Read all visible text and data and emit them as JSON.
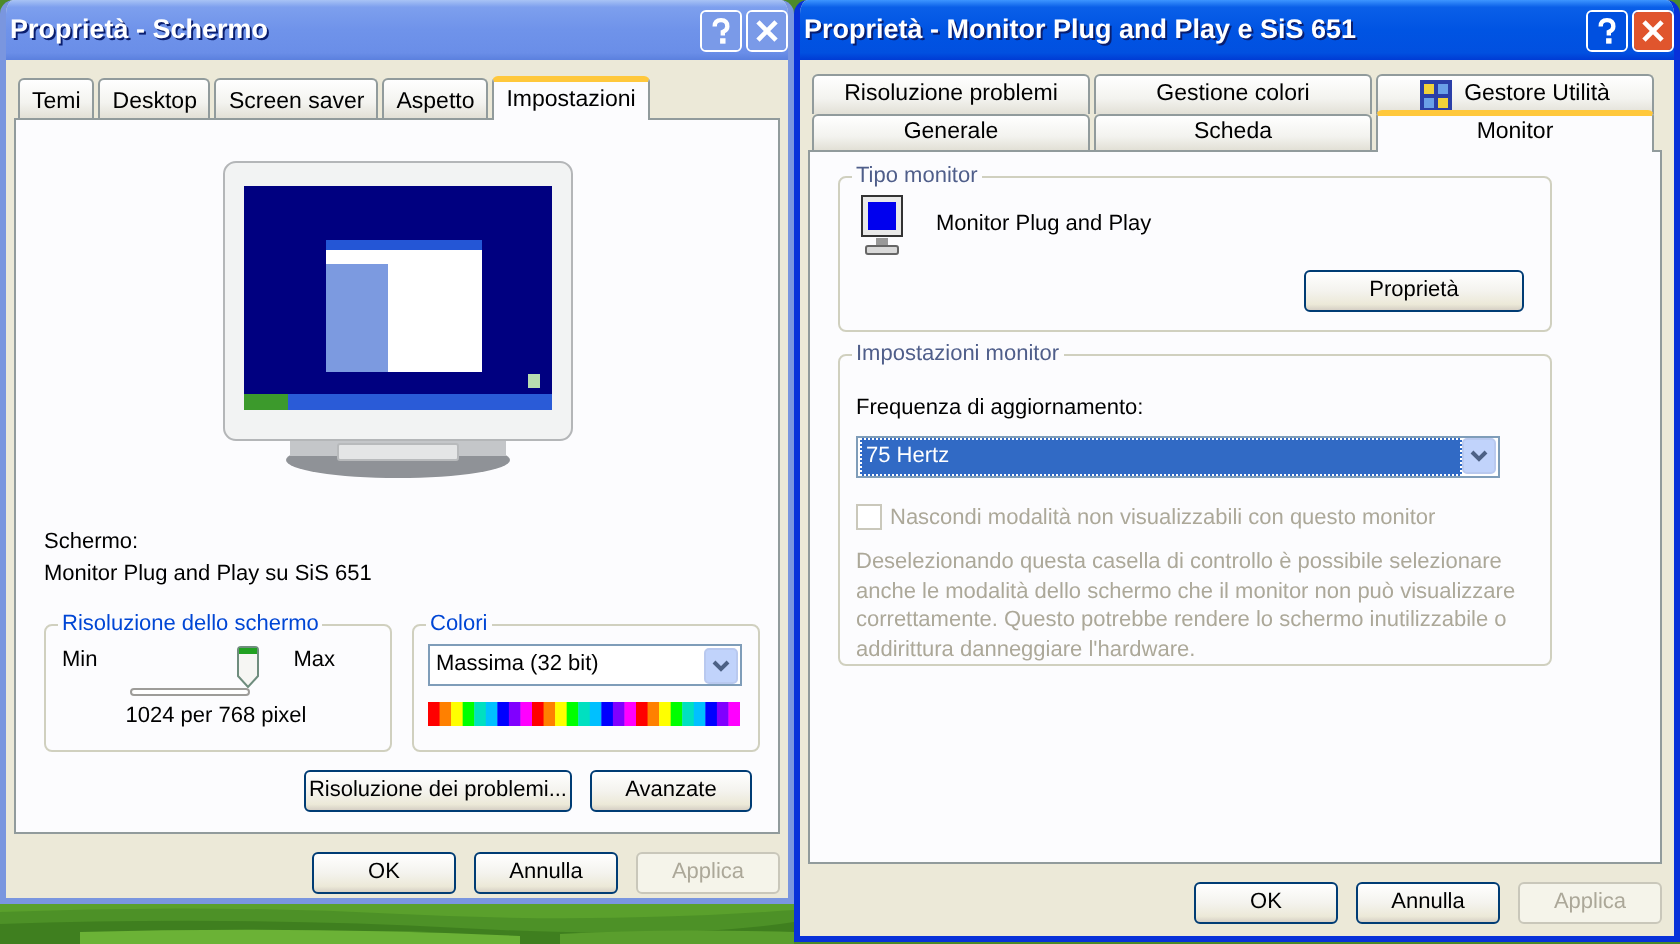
{
  "display_window": {
    "title": "Proprietà - Schermo",
    "active": false,
    "tabs": [
      {
        "label": "Temi",
        "selected": false
      },
      {
        "label": "Desktop",
        "selected": false
      },
      {
        "label": "Screen saver",
        "selected": false
      },
      {
        "label": "Aspetto",
        "selected": false
      },
      {
        "label": "Impostazioni",
        "selected": true
      }
    ],
    "display_label": "Schermo:",
    "display_name": "Monitor Plug and Play su SiS 651",
    "resolution": {
      "title": "Risoluzione dello schermo",
      "min_label": "Min",
      "max_label": "Max",
      "level": 1,
      "reading": "1024 per 768 pixel"
    },
    "colors": {
      "title": "Colori",
      "value": "Massima (32 bit)"
    },
    "panel_buttons": [
      "Risoluzione dei problemi...",
      "Avanzate"
    ],
    "dialog_buttons": [
      {
        "label": "OK",
        "disabled": false
      },
      {
        "label": "Annulla",
        "disabled": false
      },
      {
        "label": "Applica",
        "disabled": true
      }
    ]
  },
  "monitor_window": {
    "title": "Proprietà - Monitor Plug and Play e SiS 651",
    "active": true,
    "tab_rows": [
      [
        {
          "label": "Risoluzione problemi",
          "selected": false,
          "kind": "text"
        },
        {
          "label": "Gestione colori",
          "selected": false,
          "kind": "text"
        },
        {
          "label": "Gestore Utilità",
          "selected": false,
          "kind": "icon"
        }
      ],
      [
        {
          "label": "Generale",
          "selected": false,
          "kind": "text"
        },
        {
          "label": "Scheda",
          "selected": false,
          "kind": "text"
        },
        {
          "label": "Monitor",
          "selected": true,
          "kind": "text"
        }
      ]
    ],
    "monitor_type": {
      "title": "Tipo monitor",
      "name": "Monitor Plug and Play",
      "button": "Proprietà"
    },
    "monitor_settings": {
      "title": "Impostazioni monitor",
      "refresh_label": "Frequenza di aggiornamento:",
      "refresh_value": "75 Hertz",
      "refresh_focused": true,
      "hide_modes": {
        "label": "Nascondi modalità non visualizzabili con questo monitor",
        "checked": false,
        "disabled": true
      },
      "note": "Deselezionando questa casella di controllo è possibile selezionare anche le modalità dello schermo che il monitor non può visualizzare correttamente. Questo potrebbe rendere lo schermo inutilizzabile o addirittura danneggiare l'hardware."
    },
    "dialog_buttons": [
      {
        "label": "OK",
        "disabled": false
      },
      {
        "label": "Annulla",
        "disabled": false
      },
      {
        "label": "Applica",
        "disabled": true
      }
    ]
  }
}
